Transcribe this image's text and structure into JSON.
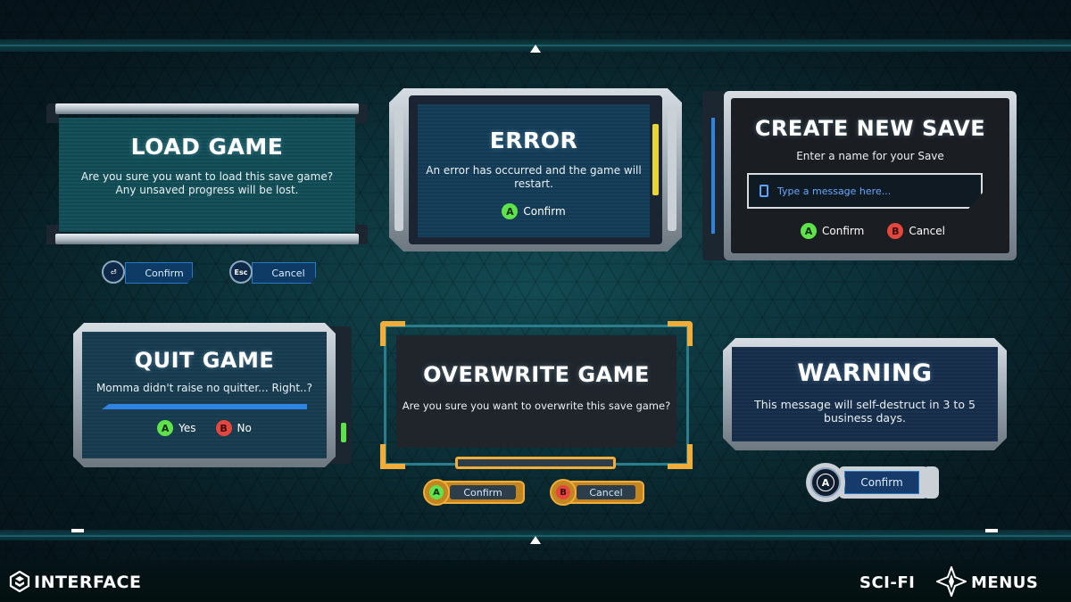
{
  "load_game": {
    "title": "LOAD GAME",
    "message_line1": "Are you sure you want to load this save game?",
    "message_line2": "Any unsaved progress will be lost.",
    "confirm_key": "⏎",
    "confirm_label": "Confirm",
    "cancel_key": "Esc",
    "cancel_label": "Cancel"
  },
  "error": {
    "title": "ERROR",
    "message_line1": "An error has occurred and the game will",
    "message_line2": "restart.",
    "confirm_key": "A",
    "confirm_label": "Confirm"
  },
  "create_save": {
    "title": "CREATE NEW SAVE",
    "subtitle": "Enter a name for your Save",
    "input_placeholder": "Type a message here...",
    "confirm_key": "A",
    "confirm_label": "Confirm",
    "cancel_key": "B",
    "cancel_label": "Cancel"
  },
  "quit_game": {
    "title": "QUIT GAME",
    "message": "Momma didn't raise no quitter... Right..?",
    "yes_key": "A",
    "yes_label": "Yes",
    "no_key": "B",
    "no_label": "No"
  },
  "overwrite_game": {
    "title": "OVERWRITE GAME",
    "message": "Are you sure you want to overwrite this save game?",
    "confirm_key": "A",
    "confirm_label": "Confirm",
    "cancel_key": "B",
    "cancel_label": "Cancel"
  },
  "warning": {
    "title": "WARNING",
    "message_line1": "This message will self-destruct in 3 to 5",
    "message_line2": "business days.",
    "confirm_key": "A",
    "confirm_label": "Confirm"
  },
  "branding": {
    "left": "INTERFACE",
    "right_part1": "SCI-FI",
    "right_part2": "MENUS"
  },
  "colors": {
    "accent_blue": "#2b78c2",
    "button_a": "#5ee34a",
    "button_b": "#e4473d",
    "orange_frame": "#f0ad3a"
  }
}
